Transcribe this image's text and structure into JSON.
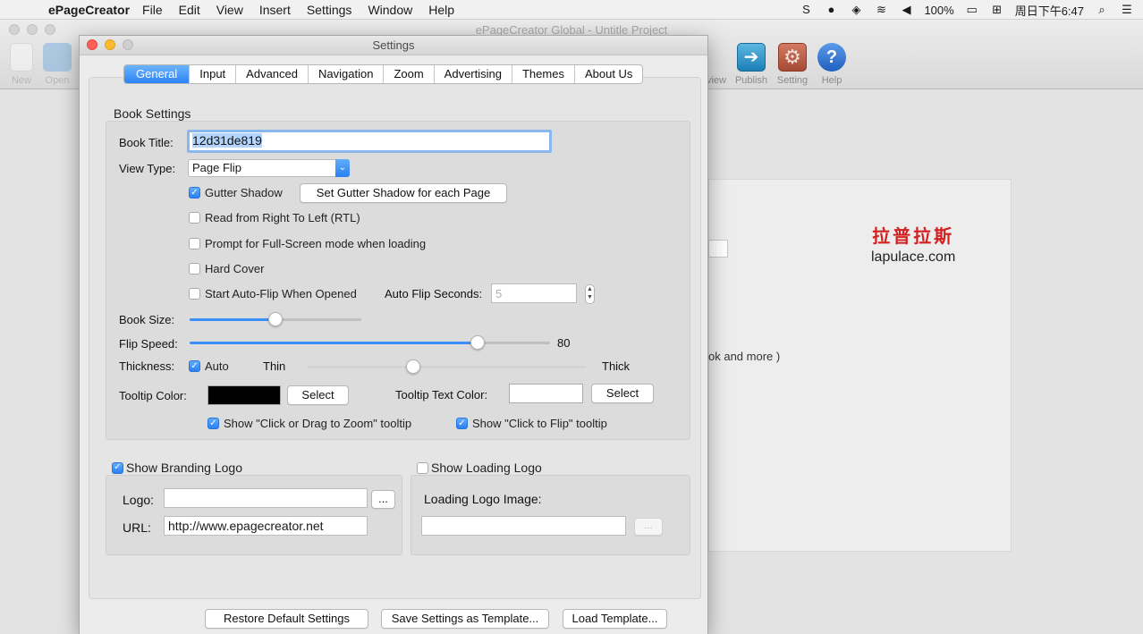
{
  "menubar": {
    "app_name": "ePageCreator",
    "menus": [
      "File",
      "Edit",
      "View",
      "Insert",
      "Settings",
      "Window",
      "Help"
    ],
    "battery": "100%",
    "clock": "周日下午6:47"
  },
  "main_window": {
    "title": "ePageCreator Global - Untitle Project",
    "toolbar": {
      "new": "New",
      "open": "Open",
      "preview": "view",
      "publish": "Publish",
      "setting": "Setting",
      "help": "Help"
    },
    "background_text": "ok and more )",
    "watermark_cn": "拉普拉斯",
    "watermark_en": "lapulace.com"
  },
  "settings": {
    "title": "Settings",
    "tabs": [
      "General",
      "Input",
      "Advanced",
      "Navigation",
      "Zoom",
      "Advertising",
      "Themes",
      "About Us"
    ],
    "active_tab": "General",
    "book_settings": {
      "section_label": "Book Settings",
      "book_title_label": "Book Title:",
      "book_title_value": "12d31de819",
      "view_type_label": "View Type:",
      "view_type_value": "Page Flip",
      "gutter_shadow_label": "Gutter Shadow",
      "gutter_shadow_checked": true,
      "gutter_shadow_button": "Set Gutter Shadow for each Page",
      "rtl_label": "Read from Right To Left (RTL)",
      "rtl_checked": false,
      "fullscreen_label": "Prompt for Full-Screen mode when loading",
      "fullscreen_checked": false,
      "hard_cover_label": "Hard Cover",
      "hard_cover_checked": false,
      "auto_flip_label": "Start Auto-Flip When Opened",
      "auto_flip_checked": false,
      "auto_flip_seconds_label": "Auto Flip Seconds:",
      "auto_flip_seconds_value": "5",
      "book_size_label": "Book Size:",
      "book_size_level": 0.5,
      "flip_speed_label": "Flip Speed:",
      "flip_speed_value": "80",
      "flip_speed_level": 0.8,
      "thickness_label": "Thickness:",
      "thickness_auto_label": "Auto",
      "thickness_auto_checked": true,
      "thickness_min_label": "Thin",
      "thickness_max_label": "Thick",
      "thickness_level": 0.38,
      "tooltip_color_label": "Tooltip Color:",
      "tooltip_color": "#000000",
      "tooltip_select_label": "Select",
      "tooltip_text_color_label": "Tooltip Text Color:",
      "tooltip_text_color": "#ffffff",
      "tooltip_text_select_label": "Select",
      "zoom_tooltip_label": "Show \"Click or Drag to Zoom\" tooltip",
      "zoom_tooltip_checked": true,
      "flip_tooltip_label": "Show \"Click to Flip\" tooltip",
      "flip_tooltip_checked": true
    },
    "branding": {
      "show_branding_label": "Show Branding Logo",
      "show_branding_checked": true,
      "logo_label": "Logo:",
      "logo_value": "",
      "browse_label": "...",
      "url_label": "URL:",
      "url_value": "http://www.epagecreator.net"
    },
    "loading": {
      "show_loading_label": "Show Loading Logo",
      "show_loading_checked": false,
      "loading_image_label": "Loading Logo Image:",
      "loading_image_value": "",
      "browse_label": "..."
    },
    "footer": {
      "restore": "Restore Default Settings",
      "save_template": "Save Settings as Template...",
      "load_template": "Load Template..."
    },
    "accent_color": "#2c83f5"
  }
}
